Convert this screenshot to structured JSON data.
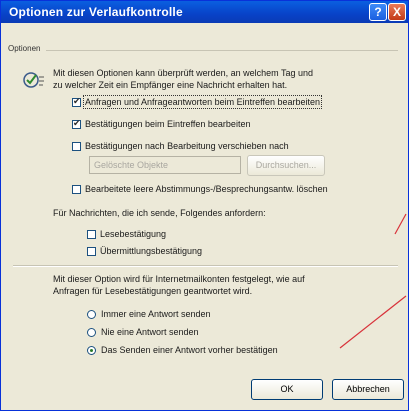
{
  "window": {
    "title": "Optionen zur Verlaufkontrolle",
    "help_glyph": "?",
    "close_glyph": "X"
  },
  "group": {
    "label": "Optionen"
  },
  "intro": {
    "line1": "Mit diesen Optionen kann überprüft werden, an welchem Tag und",
    "line2": "zu welcher Zeit ein Empfänger eine Nachricht erhalten hat."
  },
  "options": {
    "process_requests": {
      "label": "Anfragen und Anfrageantworten beim Eintreffen bearbeiten",
      "checked": true
    },
    "process_receipts": {
      "label": "Bestätigungen beim Eintreffen bearbeiten",
      "checked": true
    },
    "move_receipts": {
      "label": "Bestätigungen nach Bearbeitung verschieben nach",
      "checked": false
    },
    "folder_field": {
      "value": "Gelöschte Objekte"
    },
    "browse_button": {
      "label": "Durchsuchen..."
    },
    "delete_blank": {
      "label": "Bearbeitete leere Abstimmungs-/Besprechungsantw. löschen",
      "checked": false
    }
  },
  "request_section": {
    "heading": "Für Nachrichten, die ich sende, Folgendes anfordern:",
    "read_receipt": {
      "label": "Lesebestätigung",
      "checked": false
    },
    "delivery_receipt": {
      "label": "Übermittlungsbestätigung",
      "checked": false
    }
  },
  "response_section": {
    "line1": "Mit dieser Option wird für Internetmailkonten festgelegt, wie auf",
    "line2": "Anfragen für Lesebestätigungen geantwortet wird.",
    "always": {
      "label": "Immer eine Antwort senden",
      "selected": false
    },
    "never": {
      "label": "Nie eine Antwort senden",
      "selected": false
    },
    "ask": {
      "label": "Das Senden einer Antwort vorher bestätigen",
      "selected": true
    }
  },
  "footer": {
    "ok": "OK",
    "cancel": "Abbrechen"
  },
  "colors": {
    "title_bar": "#0842c8",
    "dialog_bg": "#ece9d8",
    "annotation": "#d8323a"
  },
  "icons": {
    "options_icon": "check-gear-icon"
  }
}
